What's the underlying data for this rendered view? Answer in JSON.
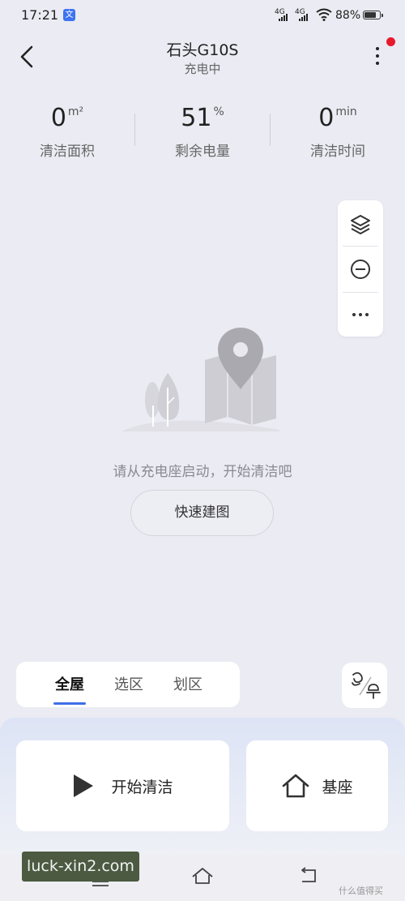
{
  "status": {
    "time": "17:21",
    "app_icon_text": "文",
    "network1": "4G",
    "network2": "4G",
    "battery": "88%"
  },
  "header": {
    "title": "石头G10S",
    "subtitle": "充电中"
  },
  "stats": [
    {
      "value": "0",
      "unit": "m²",
      "label": "清洁面积"
    },
    {
      "value": "51",
      "unit": "%",
      "label": "剩余电量"
    },
    {
      "value": "0",
      "unit": "min",
      "label": "清洁时间"
    }
  ],
  "map_tools": [
    "layers-icon",
    "minus-circle-icon",
    "more-horizontal-icon"
  ],
  "empty": {
    "message": "请从充电座启动，开始清洁吧",
    "button": "快速建图"
  },
  "modes": {
    "tabs": [
      "全屋",
      "选区",
      "划区"
    ],
    "active": "全屋"
  },
  "actions": {
    "start": "开始清洁",
    "dock": "基座"
  },
  "watermark": "luck-xin2.com",
  "corner_text": "什么值得买",
  "colors": {
    "accent": "#3f6ee8",
    "background": "#ebebf3",
    "alert_dot": "#e8192c"
  }
}
